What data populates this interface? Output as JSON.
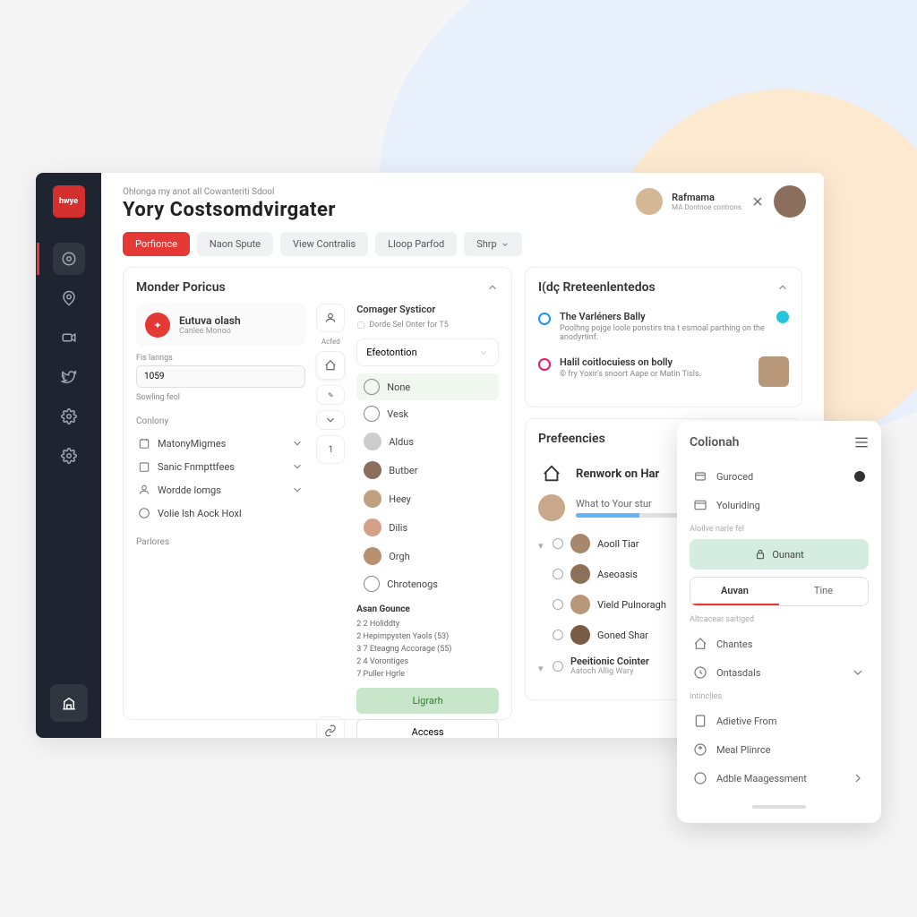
{
  "header": {
    "breadcrumb": "Ohlonga my anot all Cowanteriti Sdool",
    "title": "Yory Costsomdvirgater",
    "user_name": "Rafmama",
    "user_sub": "MA Dontnoe controns"
  },
  "tabs": {
    "t0": "Porfionce",
    "t1": "Naon Spute",
    "t2": "View Contralis",
    "t3": "Lloop Parfod",
    "t4": "Shrp"
  },
  "left_card": {
    "title": "Monder Poricus",
    "profile_name": "Eutuva olash",
    "profile_sub": "Canlee Monoo",
    "field1_label": "Fis lanngs",
    "field1_value": "1059",
    "field2_label": "Sowling feol",
    "cat_label": "Conlony",
    "items": {
      "i0": "MatonyMigmes",
      "i1": "Sanic Fnmpttfees",
      "i2": "Wordde lomgs",
      "i3": "Volie lsh Aock Hoxl"
    },
    "footer": "Parlores"
  },
  "narrow": {
    "n0": "Acfed",
    "n3": "1"
  },
  "mid": {
    "h1": "Comager Systicor",
    "h1_sub": "Dorde Sel Onter for T5",
    "dd": "Efeotontion",
    "opts": {
      "o0": "None",
      "o1": "Vesk",
      "o2": "Aldus",
      "o3": "Butber",
      "o4": "Heey",
      "o5": "Dilis",
      "o6": "Orgh",
      "o7": "Chrotenogs"
    },
    "grp": "Asan Gounce",
    "lines": {
      "l0": "2 2 Holiddty",
      "l1": "2 Hepimpysten Yaols (53)",
      "l2": "3 7 Eteagng Accorage (55)",
      "l3": "2 4 Vorontiges",
      "l4": "7 Puller Hgrle"
    },
    "btn1": "Ligrarh",
    "btn2": "Access"
  },
  "feed": {
    "title": "I(dç Rreteenlentedos",
    "i0_title": "The Varléners Bally",
    "i0_desc": "Poolhng pojge loole ponstirs tna t esmoal parthing on the anodyrtinf.",
    "i1_title": "Halil coitlocuiess on bolly",
    "i1_desc": "© fry Yoxir's snoort Aape or Matin Tisls."
  },
  "pref": {
    "title": "Prefeencies",
    "task_title": "Renwork on Har",
    "task_sub": "What to Your stur",
    "people": {
      "p0": "Aooll Tiar",
      "p1": "Aseoasis",
      "p2": "Vield Pulnoragh",
      "p3": "Goned Shar",
      "p4": "Peeitionic Cointer",
      "p4_sub": "Aatoch Allig Wary"
    }
  },
  "panel": {
    "title": "Colionah",
    "r0": "Guroced",
    "r1": "Yoluriding",
    "label1": "Aloilve narle fel",
    "pill": "Ounant",
    "seg0": "Auvan",
    "seg1": "Tine",
    "label2": "Altcacear saitiged",
    "r2": "Chantes",
    "r3": "Ontasdals",
    "label3": "Intinclies",
    "r4": "Adietive From",
    "r5": "Meal Plinrce",
    "r6": "Adble Maagessment"
  }
}
